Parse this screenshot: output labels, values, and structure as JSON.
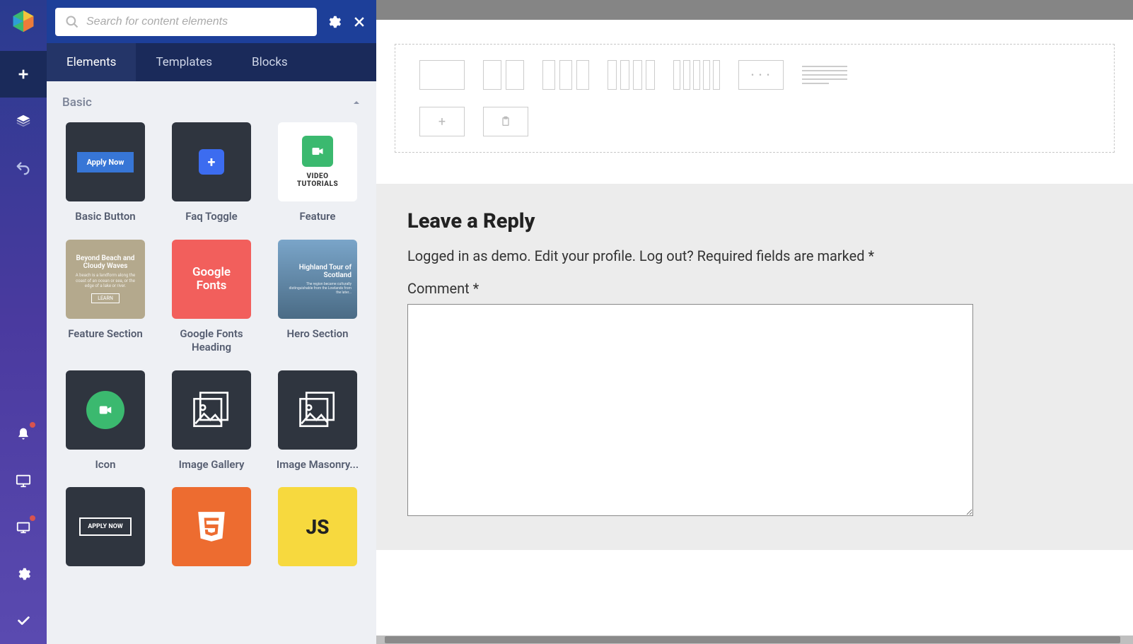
{
  "search": {
    "placeholder": "Search for content elements"
  },
  "tabs": {
    "elements": "Elements",
    "templates": "Templates",
    "blocks": "Blocks"
  },
  "section": {
    "basic": "Basic"
  },
  "tiles": {
    "basic_button": {
      "label": "Basic Button",
      "inner": "Apply Now"
    },
    "faq_toggle": {
      "label": "Faq Toggle"
    },
    "feature": {
      "label": "Feature",
      "line1": "VIDEO",
      "line2": "TUTORIALS"
    },
    "feature_section": {
      "label": "Feature Section",
      "title": "Beyond Beach and Cloudy Waves",
      "btn": "LEARN"
    },
    "google_fonts": {
      "label": "Google Fonts Heading",
      "line1": "Google",
      "line2": "Fonts"
    },
    "hero": {
      "label": "Hero Section",
      "title": "Highland Tour of Scotland"
    },
    "icon": {
      "label": "Icon"
    },
    "image_gallery": {
      "label": "Image Gallery"
    },
    "image_masonry": {
      "label": "Image Masonry..."
    },
    "outline_btn": {
      "inner": "APPLY NOW"
    },
    "js": {
      "inner": "JS"
    }
  },
  "reply": {
    "title": "Leave a Reply",
    "meta_pre": "Logged in as ",
    "meta_user": "demo",
    "meta_dot": ". ",
    "edit": "Edit your profile",
    "logout": "Log out?",
    "required": " Required fields are marked *",
    "comment_label": "Comment *"
  }
}
